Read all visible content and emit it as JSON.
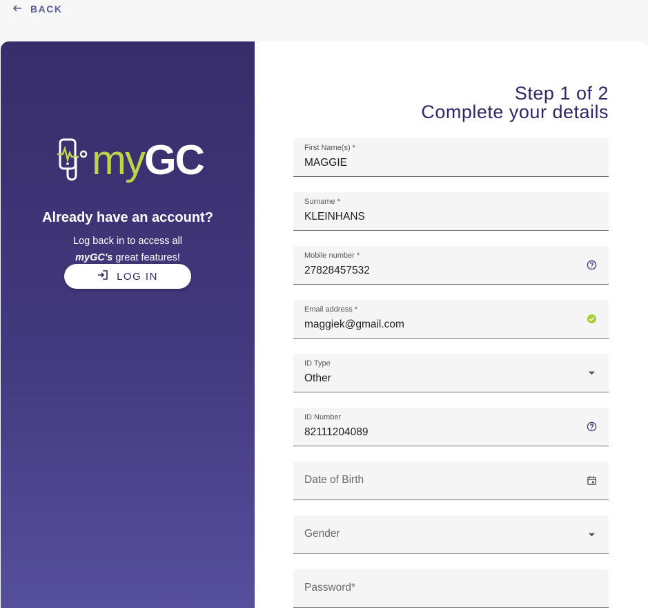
{
  "back": {
    "label": "BACK"
  },
  "left": {
    "logo_my": "my",
    "logo_gc": "GC",
    "title": "Already have an account?",
    "subtitle_line1": "Log back in to access all",
    "subtitle_brand": "myGC's",
    "subtitle_rest": " great features!",
    "login_label": "LOG IN"
  },
  "form": {
    "step": "Step 1 of 2",
    "title": "Complete your details",
    "fields": [
      {
        "label": "First Name(s) *",
        "value": "MAGGIE"
      },
      {
        "label": "Surname *",
        "value": "KLEINHANS"
      },
      {
        "label": "Mobile number *",
        "value": "27828457532",
        "icon": "help-circle-icon"
      },
      {
        "label": "Email address *",
        "value": "maggiek@gmail.com",
        "icon": "check-circle-icon"
      },
      {
        "label": "ID Type",
        "value": "Other",
        "icon": "dropdown-arrow-icon"
      },
      {
        "label": "ID Number",
        "value": "82111204089",
        "icon": "help-circle-icon"
      },
      {
        "placeholder": "Date of Birth",
        "icon": "calendar-icon"
      },
      {
        "placeholder": "Gender",
        "icon": "dropdown-arrow-icon"
      },
      {
        "placeholder": "Password*"
      }
    ]
  },
  "colors": {
    "primary": "#2e2764",
    "accent_green": "#c0d348",
    "panel_top": "#372d6a",
    "panel_bottom": "#564f9c",
    "check_green": "#a6cf3a"
  }
}
